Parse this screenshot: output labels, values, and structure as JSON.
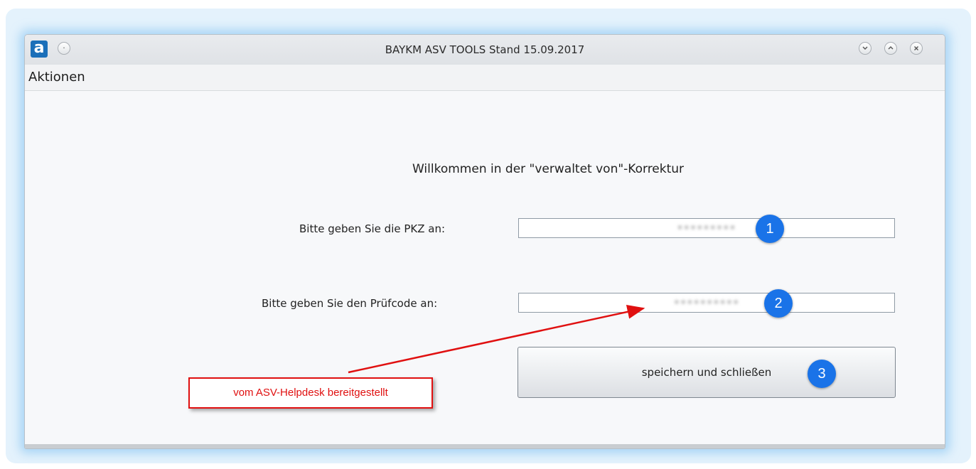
{
  "window": {
    "app_icon_letter": "a",
    "title": "BAYKM ASV TOOLS Stand 15.09.2017",
    "controls": [
      "minimize",
      "maximize",
      "close"
    ]
  },
  "menu": {
    "items": [
      "Aktionen"
    ]
  },
  "form": {
    "welcome": "Willkommen in der \"verwaltet von\"-Korrektur",
    "pkz_label": "Bitte geben Sie die PKZ an:",
    "pkz_value": "•••••••••",
    "pruefcode_label": "Bitte geben Sie den Prüfcode an:",
    "pruefcode_value": "••••••••••",
    "save_button": "speichern und schließen"
  },
  "annotations": {
    "badges": [
      "1",
      "2",
      "3"
    ],
    "callout": "vom ASV-Helpdesk bereitgestellt",
    "callout_color": "#e01010",
    "badge_color": "#1a73e8"
  }
}
